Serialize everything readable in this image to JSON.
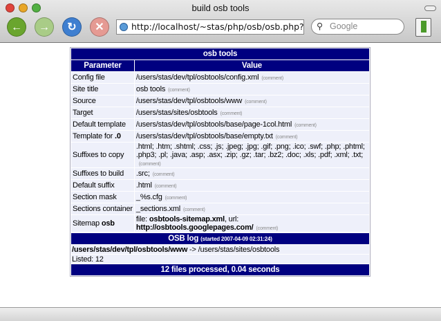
{
  "window": {
    "title": "build osb tools"
  },
  "toolbar": {
    "url": "http://localhost/~stas/php/osb/osb.php?c",
    "search_placeholder": "Google",
    "back": "back-icon",
    "forward": "forward-icon",
    "reload": "reload-icon",
    "stop": "stop-icon"
  },
  "table": {
    "title": "osb tools",
    "headers": [
      "Parameter",
      "Value"
    ],
    "comment_label": "(comment)",
    "rows": [
      {
        "param": "Config file",
        "value": "/users/stas/dev/tpl/osbtools/config.xml"
      },
      {
        "param": "Site title",
        "value": "osb tools"
      },
      {
        "param": "Source",
        "value": "/users/stas/dev/tpl/osbtools/www"
      },
      {
        "param": "Target",
        "value": "/users/stas/sites/osbtools"
      },
      {
        "param": "Default template",
        "value": "/users/stas/dev/tpl/osbtools/base/page-1col.html"
      },
      {
        "param": "Template for ",
        "param_bold": ".0",
        "value": "/users/stas/dev/tpl/osbtools/base/empty.txt"
      },
      {
        "param": "Suffixes to copy",
        "value": ".html; .htm; .shtml; .css; .js; .jpeg; .jpg; .gif; .png; .ico; .swf; .php; .phtml; .php3; .pl; .java; .asp; .asx; .zip; .gz; .tar; .bz2; .doc; .xls; .pdf; .xml; .txt;"
      },
      {
        "param": "Suffixes to build",
        "value": ".src;"
      },
      {
        "param": "Default suffix",
        "value": ".html"
      },
      {
        "param": "Section mask",
        "value": "_%s.cfg"
      },
      {
        "param": "Sections container",
        "value": "_sections.xml"
      },
      {
        "param": "Sitemap ",
        "param_bold": "osb",
        "value_prefix": "file: ",
        "file": "osbtools-sitemap.xml",
        "value_mid": ", url: ",
        "url": "http://osbtools.googlepages.com/"
      }
    ]
  },
  "log": {
    "title": "OSB log",
    "started": "(started 2007-04-09 02:31:24)",
    "line1_bold": "/users/stas/dev/tpl/osbtools/www",
    "line1_rest": " -> /users/stas/sites/osbtools",
    "line2": "Listed: 12",
    "footer": "12 files processed, 0.04 seconds"
  }
}
